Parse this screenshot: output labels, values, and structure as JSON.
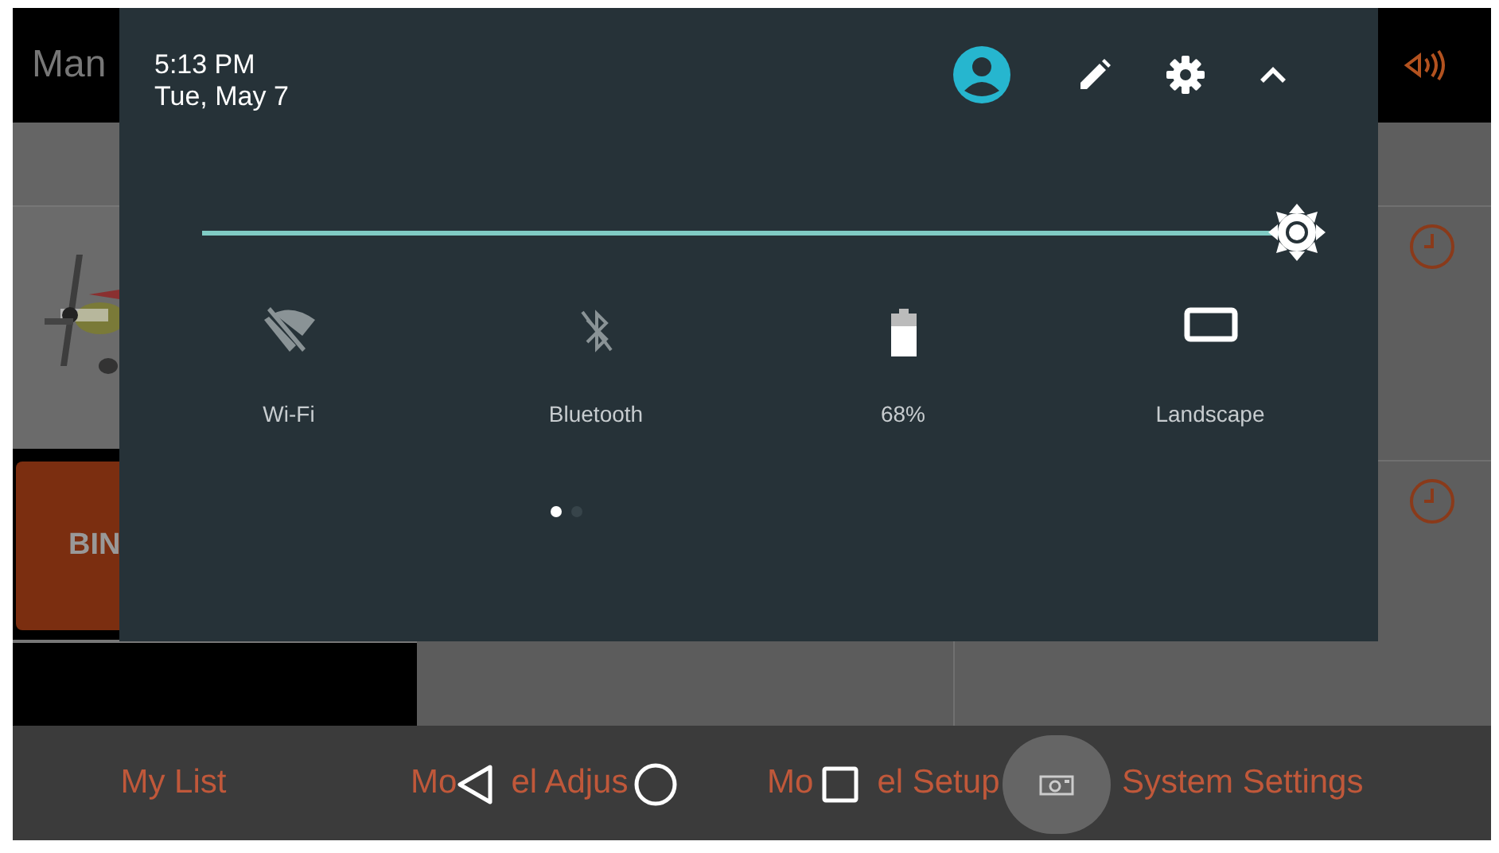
{
  "background_app": {
    "header_title": "Man",
    "button_label": "BIN",
    "tabs": [
      {
        "parts": [
          "My List"
        ]
      },
      {
        "parts": [
          "Mo",
          "el Adjus"
        ]
      },
      {
        "parts": [
          "Mo",
          "el Setup"
        ]
      },
      {
        "parts": [
          "System Settings"
        ]
      }
    ]
  },
  "quick_settings": {
    "time": "5:13 PM",
    "date": "Tue, May 7",
    "brightness": {
      "level": 1
    },
    "tiles": [
      {
        "kind": "wifi",
        "label": "Wi-Fi",
        "on": false
      },
      {
        "kind": "bluetooth",
        "label": "Bluetooth",
        "on": false
      },
      {
        "kind": "battery",
        "label": "68%"
      },
      {
        "kind": "rotation",
        "label": "Landscape"
      }
    ],
    "pages": [
      {
        "selected": true
      },
      {
        "selected": false
      }
    ]
  }
}
